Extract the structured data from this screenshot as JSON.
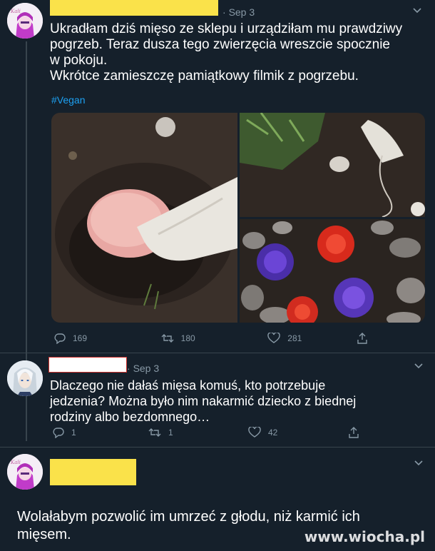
{
  "tweets": [
    {
      "date": "Sep 3",
      "text_lines": [
        "Ukradłam dziś mięso ze sklepu i urządziłam mu prawdziwy",
        "pogrzeb. Teraz dusza tego zwierzęcia wreszcie spocznie",
        "w pokoju.",
        "Wkrótce zamieszczę pamiątkowy filmik z pogrzebu."
      ],
      "hashtag": "#Vegan",
      "actions": {
        "replies": "169",
        "retweets": "180",
        "likes": "281"
      }
    },
    {
      "date": "Sep 3",
      "text_lines": [
        "Dlaczego nie dałaś mięsa komuś, kto potrzebuje",
        "jedzenia? Można było nim nakarmić dziecko z biednej",
        "rodziny albo bezdomnego…"
      ],
      "actions": {
        "replies": "1",
        "retweets": "1",
        "likes": "42"
      }
    },
    {
      "text_lines": [
        "Wolałabym pozwolić im umrzeć z głodu, niż karmić ich",
        "mięsem."
      ]
    }
  ],
  "watermark": "www.wiocha.pl",
  "colors": {
    "background": "#15202b",
    "muted": "#8899a6",
    "link": "#1da1f2",
    "redaction": "#fae24a"
  },
  "icons": [
    "reply-icon",
    "retweet-icon",
    "like-icon",
    "share-icon",
    "chevron-down-icon"
  ]
}
